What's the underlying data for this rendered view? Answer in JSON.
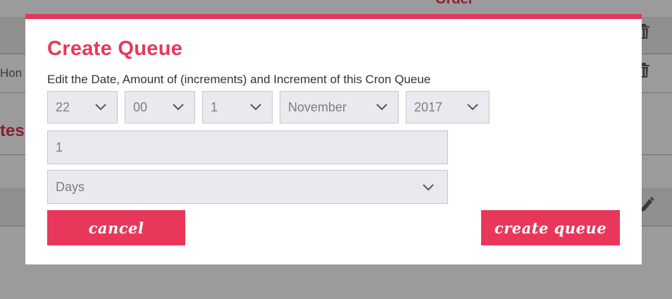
{
  "background": {
    "top_heading_fragment": "Order",
    "row_text_fragment": "Hon",
    "section_heading_fragment": "tes"
  },
  "modal": {
    "title": "Create Queue",
    "subtitle": "Edit the Date, Amount of (increments) and Increment of this Cron Queue",
    "selects": {
      "hour": "22",
      "minute": "00",
      "day": "1",
      "month": "November",
      "year": "2017"
    },
    "amount_value": "1",
    "increment_unit": "Days",
    "cancel_label": "cancel",
    "create_label": "create queue"
  },
  "colors": {
    "accent": "#e8375a",
    "field_bg": "#ebe9ee",
    "overlay": "#9b9b9b"
  },
  "icons": [
    "trash-icon",
    "trash-icon",
    "pencil-icon",
    "chevron-down-icon"
  ]
}
